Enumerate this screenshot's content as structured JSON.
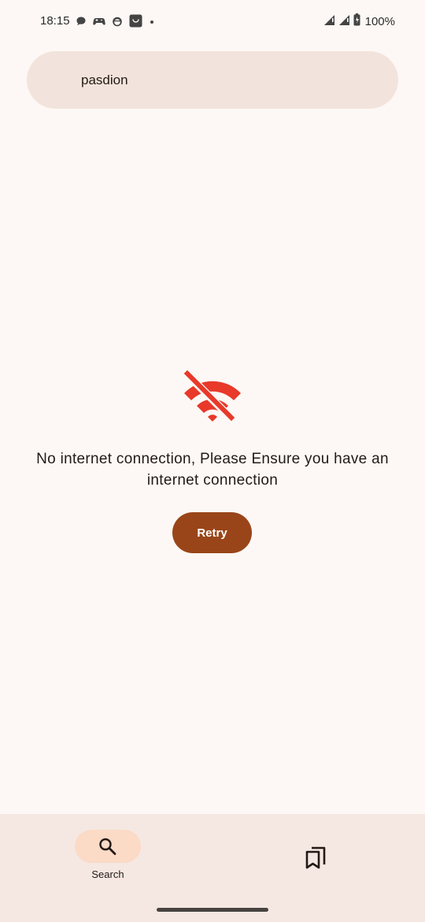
{
  "status_bar": {
    "time": "18:15",
    "battery_percent": "100%",
    "notification_icons": [
      "chat-bubble-icon",
      "gamepad-icon",
      "cat-face-icon",
      "app-box-icon",
      "more-dot-icon"
    ],
    "system_icons": [
      "signal-icon",
      "signal-icon",
      "battery-icon"
    ]
  },
  "search": {
    "value": "pasdion"
  },
  "error": {
    "icon": "wifi-off-icon",
    "message": "No internet connection, Please Ensure you have an internet connection",
    "retry_label": "Retry",
    "color": "#e8392a"
  },
  "bottom_nav": {
    "items": [
      {
        "label": "Search",
        "icon": "search-icon",
        "active": true
      },
      {
        "label": "",
        "icon": "bookmarks-icon",
        "active": false
      }
    ]
  },
  "colors": {
    "background": "#fdf8f5",
    "search_bar": "#f2e4dc",
    "accent": "#994519",
    "nav_background": "#f5e8e2",
    "nav_active_pill": "#fbdac6"
  }
}
